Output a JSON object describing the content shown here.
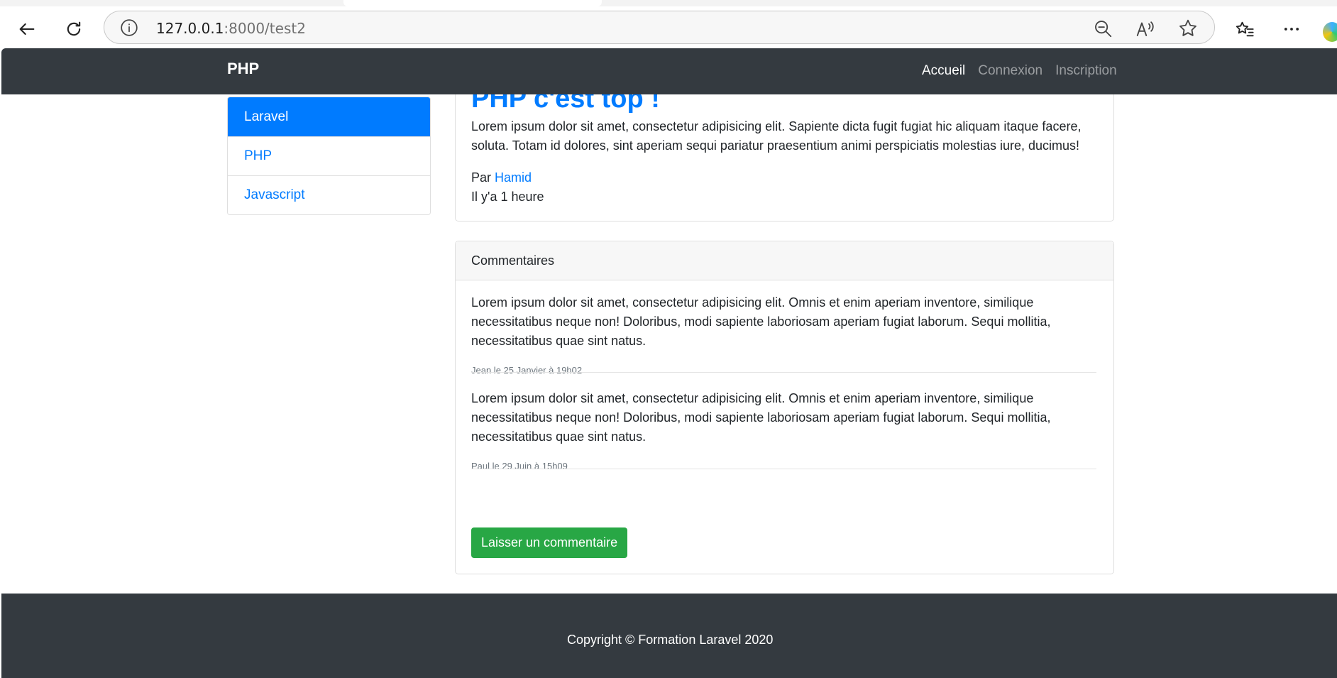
{
  "browser": {
    "url_host": "127.0.0.1",
    "url_rest": ":8000/test2",
    "icons": [
      "back-arrow-icon",
      "reload-icon",
      "site-info-icon",
      "zoom-out-icon",
      "read-aloud-icon",
      "favorite-star-icon",
      "favorites-icon",
      "more-icon",
      "copilot-icon"
    ]
  },
  "navbar": {
    "brand": "PHP",
    "links": [
      {
        "label": "Accueil"
      },
      {
        "label": "Connexion"
      },
      {
        "label": "Inscription"
      }
    ]
  },
  "sidebar": {
    "items": [
      {
        "label": "Laravel"
      },
      {
        "label": "PHP"
      },
      {
        "label": "Javascript"
      }
    ]
  },
  "post": {
    "title": "PHP c'est top !",
    "body": "Lorem ipsum dolor sit amet, consectetur adipisicing elit. Sapiente dicta fugit fugiat hic aliquam itaque facere, soluta. Totam id dolores, sint aperiam sequi pariatur praesentium animi perspiciatis molestias iure, ducimus!",
    "author_prefix": "Par",
    "author": "Hamid",
    "time": "Il y'a 1 heure"
  },
  "comments": {
    "header": "Commentaires",
    "items": [
      {
        "text": "Lorem ipsum dolor sit amet, consectetur adipisicing elit. Omnis et enim aperiam inventore, similique necessitatibus neque non! Doloribus, modi sapiente laboriosam aperiam fugiat laborum. Sequi mollitia, necessitatibus quae sint natus.",
        "meta": "Jean le 25 Janvier à 19h02"
      },
      {
        "text": "Lorem ipsum dolor sit amet, consectetur adipisicing elit. Omnis et enim aperiam inventore, similique necessitatibus neque non! Doloribus, modi sapiente laboriosam aperiam fugiat laborum. Sequi mollitia, necessitatibus quae sint natus.",
        "meta": "Paul le 29 Juin à 15h09"
      }
    ],
    "button_label": "Laisser un commentaire"
  },
  "footer": {
    "text": "Copyright © Formation Laravel 2020"
  },
  "colors": {
    "dark": "#343a40",
    "primary": "#007bff",
    "success": "#28a745",
    "muted": "#6c757d"
  }
}
